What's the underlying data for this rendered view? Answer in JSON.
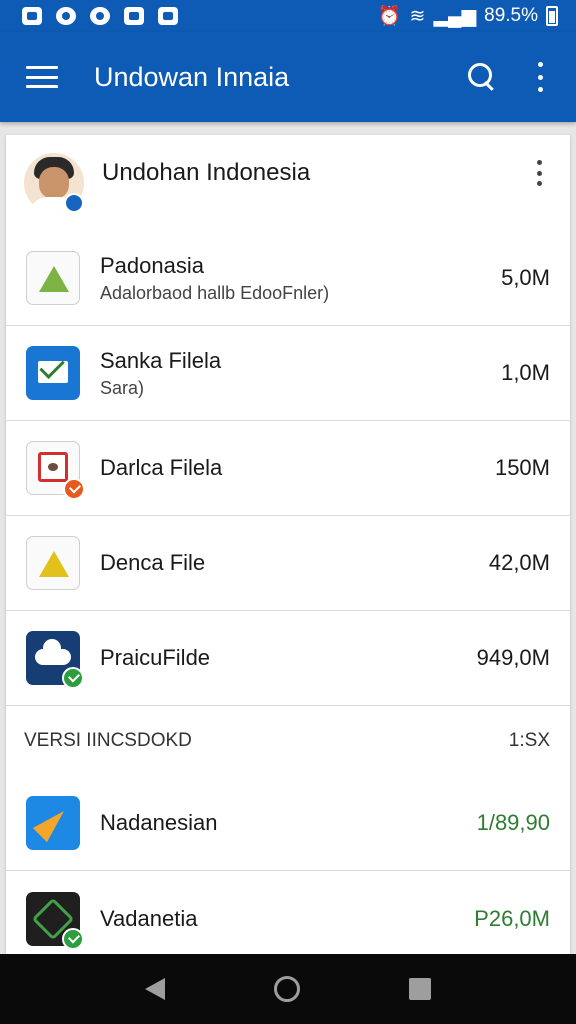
{
  "status_bar": {
    "battery_text": "89.5%"
  },
  "app_bar": {
    "title": "Undowan Innaia"
  },
  "profile": {
    "name": "Undohan Indonesia"
  },
  "files": [
    {
      "title": "Padonasia",
      "subtitle": "Adalorbaod hallb EdooFnler)",
      "size": "5,0M",
      "icon": "green-triangle-icon"
    },
    {
      "title": "Sanka Filela",
      "subtitle": "Sara)",
      "size": "1,0M",
      "icon": "mail-icon"
    },
    {
      "title": "Darlca Filela",
      "subtitle": "",
      "size": "150M",
      "icon": "calendar-icon"
    },
    {
      "title": "Denca File",
      "subtitle": "",
      "size": "42,0M",
      "icon": "yellow-triangle-icon"
    },
    {
      "title": "PraicuFilde",
      "subtitle": "",
      "size": "949,0M",
      "icon": "cloud-icon"
    }
  ],
  "section": {
    "label": "VERSI IINCSDOKD",
    "meta": "1:SX"
  },
  "files2": [
    {
      "title": "Nadanesian",
      "size": "1/89,90",
      "icon": "plane-icon",
      "size_color": "#2e7d32"
    },
    {
      "title": "Vadanetia",
      "size": "P26,0M",
      "icon": "gem-icon",
      "size_color": "#2e7d32"
    }
  ],
  "colors": {
    "primary": "#0d5bb5",
    "accent_green": "#2e9d3f",
    "accent_orange": "#e65a1f"
  }
}
